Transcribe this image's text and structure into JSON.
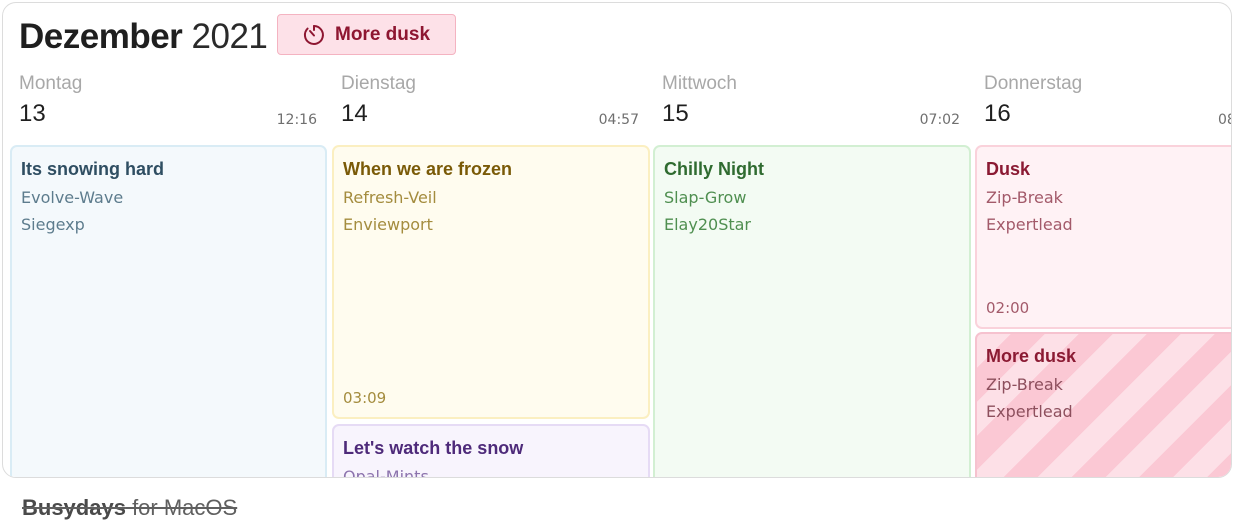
{
  "header": {
    "month": "Dezember",
    "year": "2021",
    "badge": {
      "label": "More dusk",
      "icon": "timer-icon"
    }
  },
  "days": [
    {
      "name": "Montag",
      "number": "13",
      "time": "12:16"
    },
    {
      "name": "Dienstag",
      "number": "14",
      "time": "04:57"
    },
    {
      "name": "Mittwoch",
      "number": "15",
      "time": "07:02"
    },
    {
      "name": "Donnerstag",
      "number": "16",
      "time": "08"
    }
  ],
  "events": [
    {
      "title": "Its snowing hard",
      "line1": "Evolve-Wave",
      "line2": "Siegexp",
      "color": "#f4f9fc"
    },
    {
      "title": "When we are frozen",
      "line1": "Refresh-Veil",
      "line2": "Enviewport",
      "time": "03:09",
      "color": "#fffcef"
    },
    {
      "title": "Let's watch the snow",
      "line1": "Opal-Mints",
      "color": "#f8f4fd"
    },
    {
      "title": "Chilly Night",
      "line1": "Slap-Grow",
      "line2": "Elay20Star",
      "color": "#f3fbf3"
    },
    {
      "title": "Dusk",
      "line1": "Zip-Break",
      "line2": "Expertlead",
      "time": "02:00",
      "color": "#fff2f5"
    },
    {
      "title": "More dusk",
      "line1": "Zip-Break",
      "line2": "Expertlead",
      "color": "#fde0e7"
    }
  ],
  "caption": {
    "brand": "Busydays",
    "rest": " for MacOS"
  }
}
